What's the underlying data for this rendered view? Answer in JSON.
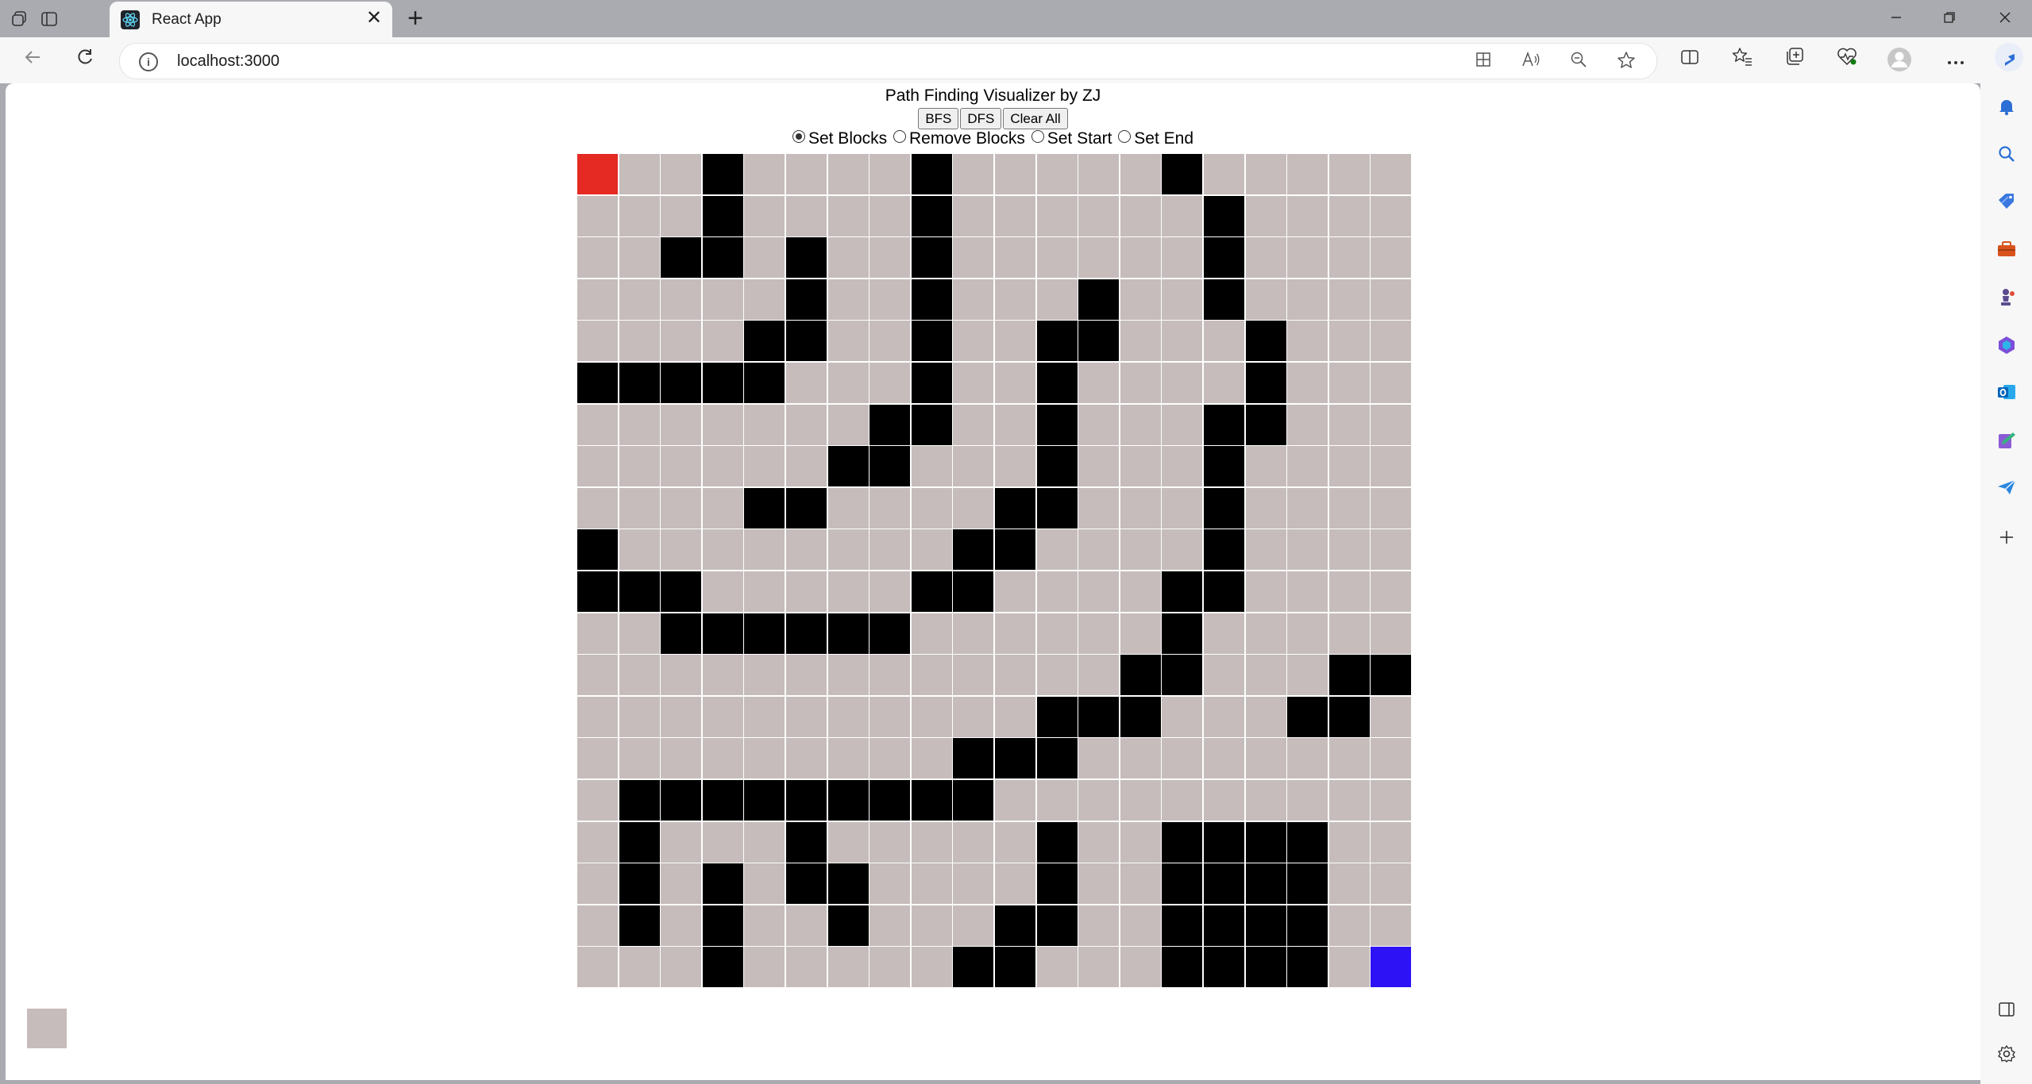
{
  "browser": {
    "tab_title": "React App",
    "url": "localhost:3000",
    "tab_close_glyph": "✕",
    "new_tab_glyph": "+"
  },
  "app": {
    "title": "Path Finding Visualizer by ZJ",
    "buttons": [
      "BFS",
      "DFS",
      "Clear All"
    ],
    "modes": [
      {
        "label": "Set Blocks",
        "selected": true
      },
      {
        "label": "Remove Blocks",
        "selected": false
      },
      {
        "label": "Set Start",
        "selected": false
      },
      {
        "label": "Set End",
        "selected": false
      }
    ]
  },
  "grid": {
    "rows": 20,
    "cols": 20,
    "start": [
      0,
      0
    ],
    "end": [
      19,
      19
    ],
    "colors": {
      "empty": "#c5bcbb",
      "block": "#000000",
      "start": "#e42a22",
      "end": "#2d12f5"
    },
    "blocks": [
      [
        0,
        3
      ],
      [
        0,
        8
      ],
      [
        0,
        14
      ],
      [
        1,
        3
      ],
      [
        1,
        8
      ],
      [
        1,
        15
      ],
      [
        2,
        2
      ],
      [
        2,
        3
      ],
      [
        2,
        5
      ],
      [
        2,
        8
      ],
      [
        2,
        15
      ],
      [
        3,
        5
      ],
      [
        3,
        8
      ],
      [
        3,
        12
      ],
      [
        3,
        15
      ],
      [
        4,
        4
      ],
      [
        4,
        5
      ],
      [
        4,
        8
      ],
      [
        4,
        11
      ],
      [
        4,
        12
      ],
      [
        4,
        16
      ],
      [
        5,
        0
      ],
      [
        5,
        1
      ],
      [
        5,
        2
      ],
      [
        5,
        3
      ],
      [
        5,
        4
      ],
      [
        5,
        8
      ],
      [
        5,
        11
      ],
      [
        5,
        16
      ],
      [
        6,
        7
      ],
      [
        6,
        8
      ],
      [
        6,
        11
      ],
      [
        6,
        15
      ],
      [
        6,
        16
      ],
      [
        7,
        6
      ],
      [
        7,
        7
      ],
      [
        7,
        11
      ],
      [
        7,
        15
      ],
      [
        8,
        4
      ],
      [
        8,
        5
      ],
      [
        8,
        10
      ],
      [
        8,
        11
      ],
      [
        8,
        15
      ],
      [
        9,
        0
      ],
      [
        9,
        9
      ],
      [
        9,
        10
      ],
      [
        9,
        15
      ],
      [
        10,
        0
      ],
      [
        10,
        1
      ],
      [
        10,
        2
      ],
      [
        10,
        8
      ],
      [
        10,
        9
      ],
      [
        10,
        14
      ],
      [
        10,
        15
      ],
      [
        11,
        2
      ],
      [
        11,
        3
      ],
      [
        11,
        4
      ],
      [
        11,
        5
      ],
      [
        11,
        6
      ],
      [
        11,
        7
      ],
      [
        11,
        14
      ],
      [
        12,
        13
      ],
      [
        12,
        14
      ],
      [
        12,
        18
      ],
      [
        12,
        19
      ],
      [
        13,
        11
      ],
      [
        13,
        12
      ],
      [
        13,
        13
      ],
      [
        13,
        17
      ],
      [
        13,
        18
      ],
      [
        14,
        9
      ],
      [
        14,
        10
      ],
      [
        14,
        11
      ],
      [
        15,
        1
      ],
      [
        15,
        2
      ],
      [
        15,
        3
      ],
      [
        15,
        4
      ],
      [
        15,
        5
      ],
      [
        15,
        6
      ],
      [
        15,
        7
      ],
      [
        15,
        8
      ],
      [
        15,
        9
      ],
      [
        16,
        1
      ],
      [
        16,
        5
      ],
      [
        16,
        11
      ],
      [
        16,
        14
      ],
      [
        16,
        15
      ],
      [
        16,
        16
      ],
      [
        16,
        17
      ],
      [
        17,
        1
      ],
      [
        17,
        3
      ],
      [
        17,
        5
      ],
      [
        17,
        6
      ],
      [
        17,
        11
      ],
      [
        17,
        14
      ],
      [
        17,
        15
      ],
      [
        17,
        16
      ],
      [
        17,
        17
      ],
      [
        18,
        1
      ],
      [
        18,
        3
      ],
      [
        18,
        6
      ],
      [
        18,
        10
      ],
      [
        18,
        11
      ],
      [
        18,
        14
      ],
      [
        18,
        15
      ],
      [
        18,
        16
      ],
      [
        18,
        17
      ],
      [
        19,
        3
      ],
      [
        19,
        9
      ],
      [
        19,
        10
      ],
      [
        19,
        14
      ],
      [
        19,
        15
      ],
      [
        19,
        16
      ],
      [
        19,
        17
      ]
    ]
  },
  "icons": {
    "titlebar": [
      "workspaces-icon",
      "tab-actions-icon"
    ],
    "toolbar": [
      "app-available-icon",
      "read-aloud-icon",
      "zoom-out-icon",
      "favorite-star-icon",
      "split-screen-icon",
      "favorites-icon",
      "collections-icon",
      "browser-essentials-icon",
      "profile-icon",
      "more-menu-icon",
      "copilot-icon"
    ],
    "sidebar": [
      "notifications-icon",
      "search-icon",
      "shopping-icon",
      "tools-icon",
      "games-icon",
      "microsoft365-icon",
      "outlook-icon",
      "designer-icon",
      "drop-icon",
      "add-icon",
      "hide-sidebar-icon",
      "settings-icon"
    ]
  }
}
